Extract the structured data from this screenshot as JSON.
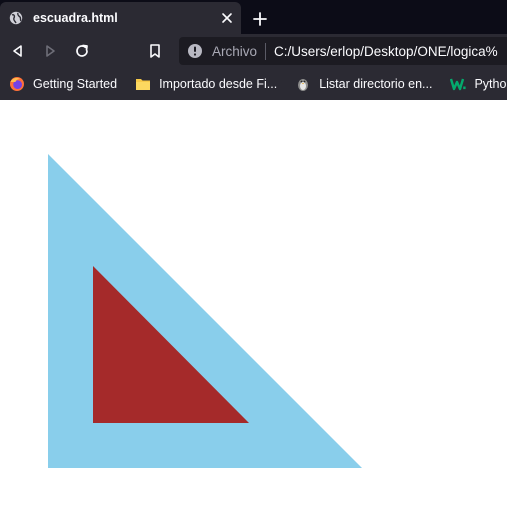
{
  "browser": {
    "tab": {
      "title": "escuadra.html"
    },
    "urlbar": {
      "label": "Archivo",
      "url": "C:/Users/erlop/Desktop/ONE/logica%"
    },
    "bookmarks": [
      {
        "label": "Getting Started",
        "icon": "firefox-icon"
      },
      {
        "label": "Importado desde Fi...",
        "icon": "folder-icon"
      },
      {
        "label": "Listar directorio en...",
        "icon": "penguin-icon"
      },
      {
        "label": "Python Fu",
        "icon": "w3-icon"
      }
    ]
  },
  "colors": {
    "outer_triangle": "#89ceeb",
    "inner_triangle": "#a52a2a",
    "tabbar": "#0c0c17",
    "toolbar": "#2b2a33"
  }
}
